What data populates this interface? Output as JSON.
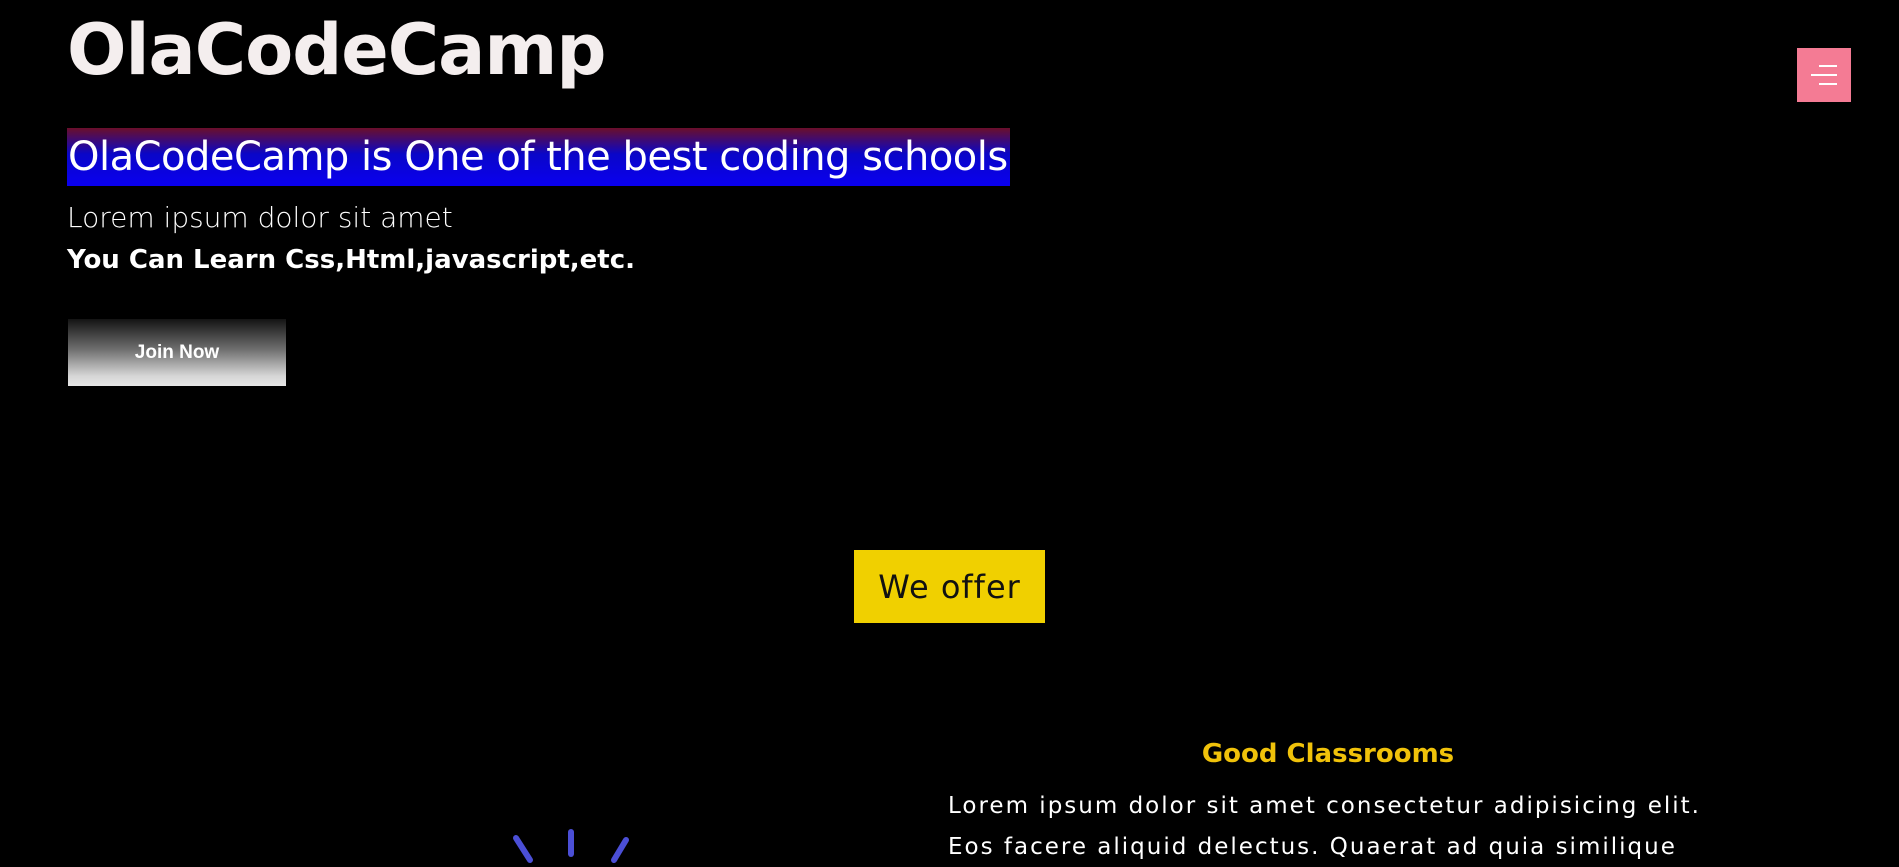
{
  "header": {
    "title": "OlaCodeCamp",
    "menu_icon": "menu-icon"
  },
  "hero": {
    "tagline": "OlaCodeCamp is One of the best coding schools",
    "subtitle": "Lorem ipsum dolor sit amet",
    "learn_text": "You Can Learn Css,Html,javascript,etc.",
    "join_label": "Join Now"
  },
  "offer": {
    "badge_label": "We offer",
    "feature": {
      "title": "Good Classrooms",
      "lines": [
        "Lorem ipsum dolor sit amet consectetur adipisicing elit.",
        "Eos facere aliquid delectus. Quaerat ad quia similique"
      ]
    }
  },
  "colors": {
    "background": "#000000",
    "menu_button": "#f47b94",
    "offer_badge": "#f0d000",
    "feature_title": "#f0c20a",
    "spinner": "#4b4fd6"
  }
}
